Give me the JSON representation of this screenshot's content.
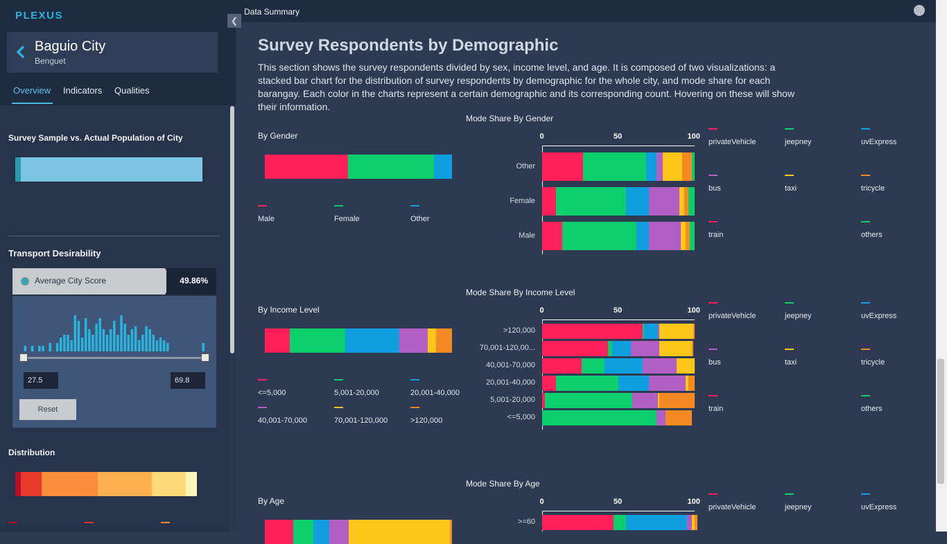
{
  "app": {
    "logo": "PLEXUS",
    "collapse_icon": "chevron-left-icon"
  },
  "city": {
    "name": "Baguio City",
    "province": "Benguet"
  },
  "tabs": [
    {
      "label": "Overview",
      "active": true
    },
    {
      "label": "Indicators"
    },
    {
      "label": "Qualities"
    }
  ],
  "sidebar": {
    "sample_title": "Survey Sample vs. Actual Population of City",
    "transport_title": "Transport Desirability",
    "score_label": "Average City Score",
    "score_value": "49.86%",
    "range_min": "27.5",
    "range_max": "69.8",
    "reset_label": "Reset",
    "distribution_title": "Distribution",
    "colors": {
      "sample": "#7cc5e3",
      "sample_marker": "#2a9ca9",
      "hist": "#2ab4dd"
    }
  },
  "main": {
    "topbar_title": "Data Summary",
    "title": "Survey Respondents by Demographic",
    "description": "This section shows the survey respondents divided by sex, income level, and age. It is composed of two visualizations: a stacked bar chart for the distribution of survey respondents by demographic for the whole city, and mode share for each barangay. Each color in the charts represent a certain demographic and its corresponding count. Hovering on these will show their information."
  },
  "mode_legend": [
    "privateVehicle",
    "jeepney",
    "uvExpress",
    "bus",
    "taxi",
    "tricycle",
    "train",
    "others"
  ],
  "mode_colors": [
    "#ff1f5a",
    "#0acf6b",
    "#0f9ee0",
    "#b15fc5",
    "#ffc61a",
    "#f58a24",
    "#ff1f5a",
    "#0acf6b"
  ],
  "gender": {
    "section_title": "By Gender",
    "legend": [
      "Male",
      "Female",
      "Other"
    ],
    "colors": [
      "#ff1f5a",
      "#0acf6b",
      "#0f9ee0"
    ],
    "shares": [
      44.5,
      46,
      9.5
    ]
  },
  "income": {
    "section_title": "By Income Level",
    "legend": [
      "<=5,000",
      "5,001-20,000",
      "20,001-40,000",
      "40,001-70,000",
      "70,001-120,000",
      ">120,000"
    ],
    "colors": [
      "#ff1f5a",
      "#0acf6b",
      "#0f9ee0",
      "#b15fc5",
      "#ffc61a",
      "#f58a24"
    ],
    "shares": [
      13.5,
      29.5,
      29,
      15,
      4.5,
      8.5
    ]
  },
  "age": {
    "section_title": "By Age",
    "colors": [
      "#ff1f5a",
      "#0acf6b",
      "#0f9ee0",
      "#b15fc5",
      "#ffc61a",
      "#f58a24"
    ],
    "shares": [
      15,
      11,
      8.5,
      10.5,
      54,
      1
    ]
  },
  "distribution": {
    "colors": [
      "#b3112a",
      "#e83a2b",
      "#fb8d3b",
      "#fdb04e",
      "#fed977",
      "#fff5b8"
    ],
    "shares": [
      3,
      11,
      30,
      29,
      18,
      6
    ]
  },
  "chart_data": [
    {
      "type": "bar",
      "title": "Mode Share By Gender",
      "categories": [
        "Other",
        "Female",
        "Male"
      ],
      "xlim": [
        0,
        100
      ],
      "ticks": [
        "0",
        "50",
        "100"
      ],
      "series": [
        {
          "name": "privateVehicle",
          "values": [
            27,
            9,
            13
          ]
        },
        {
          "name": "jeepney",
          "values": [
            41,
            46,
            49
          ]
        },
        {
          "name": "uvExpress",
          "values": [
            7,
            15,
            8
          ]
        },
        {
          "name": "bus",
          "values": [
            4,
            20,
            21
          ]
        },
        {
          "name": "taxi",
          "values": [
            13,
            3,
            3
          ]
        },
        {
          "name": "tricycle",
          "values": [
            6,
            3,
            3
          ]
        },
        {
          "name": "train",
          "values": [
            0,
            0,
            0
          ]
        },
        {
          "name": "others",
          "values": [
            2,
            4,
            3
          ]
        }
      ]
    },
    {
      "type": "bar",
      "title": "Mode Share By Income Level",
      "categories": [
        ">120,000",
        "70,001-120,00...",
        "40,001-70,000",
        "20,001-40,000",
        "5,001-20,000",
        "<=5,000"
      ],
      "xlim": [
        0,
        100
      ],
      "ticks": [
        "0",
        "50",
        "100"
      ],
      "series": [
        {
          "name": "privateVehicle",
          "values": [
            66,
            43,
            26,
            9,
            2,
            0
          ]
        },
        {
          "name": "jeepney",
          "values": [
            1,
            3,
            15,
            41,
            57,
            75
          ]
        },
        {
          "name": "uvExpress",
          "values": [
            9,
            12,
            25,
            20,
            0,
            0
          ]
        },
        {
          "name": "bus",
          "values": [
            1,
            19,
            22,
            24,
            17,
            6
          ]
        },
        {
          "name": "taxi",
          "values": [
            22,
            21,
            12,
            2,
            1,
            0
          ]
        },
        {
          "name": "tricycle",
          "values": [
            1,
            1,
            0,
            4,
            23,
            17
          ]
        },
        {
          "name": "train",
          "values": [
            0,
            0,
            0,
            0,
            0,
            0
          ]
        },
        {
          "name": "others",
          "values": [
            0,
            0,
            0,
            0,
            0,
            0
          ]
        }
      ]
    },
    {
      "type": "bar",
      "title": "Mode Share By Age",
      "categories": [
        ">=60"
      ],
      "xlim": [
        0,
        100
      ],
      "ticks": [
        "0",
        "50",
        "100"
      ],
      "series": [
        {
          "name": "privateVehicle",
          "values": [
            47
          ]
        },
        {
          "name": "jeepney",
          "values": [
            8
          ]
        },
        {
          "name": "uvExpress",
          "values": [
            40
          ]
        },
        {
          "name": "bus",
          "values": [
            3
          ]
        },
        {
          "name": "taxi",
          "values": [
            2
          ]
        },
        {
          "name": "tricycle",
          "values": [
            2
          ]
        },
        {
          "name": "train",
          "values": [
            0
          ]
        },
        {
          "name": "others",
          "values": [
            0
          ]
        }
      ]
    }
  ],
  "histogram": [
    2,
    0,
    2,
    0,
    2,
    2,
    0,
    3,
    0,
    3,
    5,
    6,
    6,
    4,
    13,
    11,
    5,
    12,
    8,
    6,
    10,
    12,
    8,
    6,
    8,
    11,
    6,
    13,
    10,
    6,
    8,
    9,
    4,
    6,
    9,
    8,
    6,
    4,
    5,
    4,
    3,
    0,
    0,
    0,
    0,
    0,
    0,
    0,
    0,
    0,
    3
  ]
}
